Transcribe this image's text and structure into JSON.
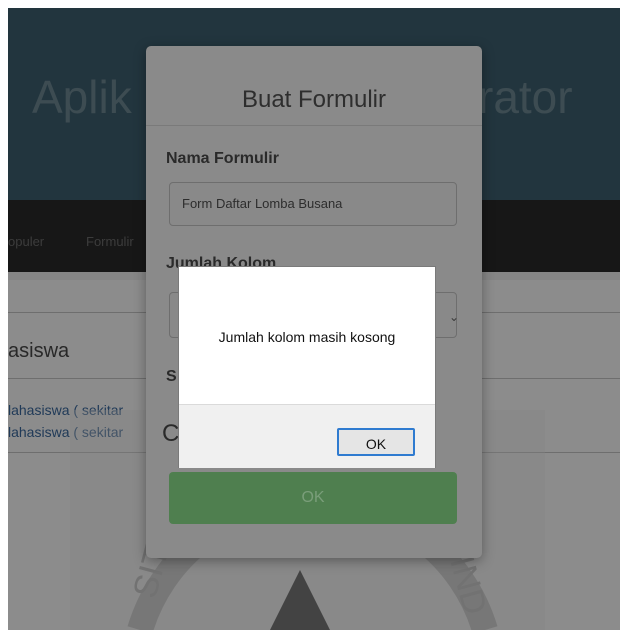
{
  "app": {
    "title_left": "Aplik",
    "title_right": "rator"
  },
  "nav": {
    "item1": "opuler",
    "item2": "Formulir"
  },
  "main": {
    "heading": "asiswa",
    "link1": "lahasiswa ( sekitar",
    "link2": "lahasiswa ( sekitar"
  },
  "watermark": {
    "text_main": "ISLAM",
    "text_right": "IND",
    "text_left": "SITAS"
  },
  "modal": {
    "title": "Buat Formulir",
    "label_name": "Nama Formulir",
    "name_value": "Form Daftar Lomba Busana",
    "label_columns_partial": "Jumlah Kolom",
    "label_s_partial": "S",
    "label_c_partial": "C",
    "ok_button": "OK"
  },
  "alert": {
    "message": "Jumlah kolom masih kosong",
    "ok_button": "OK"
  },
  "colors": {
    "header": "#3f6272",
    "navbar": "#2a2a2a",
    "ok_green": "#4f7f4f",
    "alert_focus": "#2f7bd0"
  }
}
